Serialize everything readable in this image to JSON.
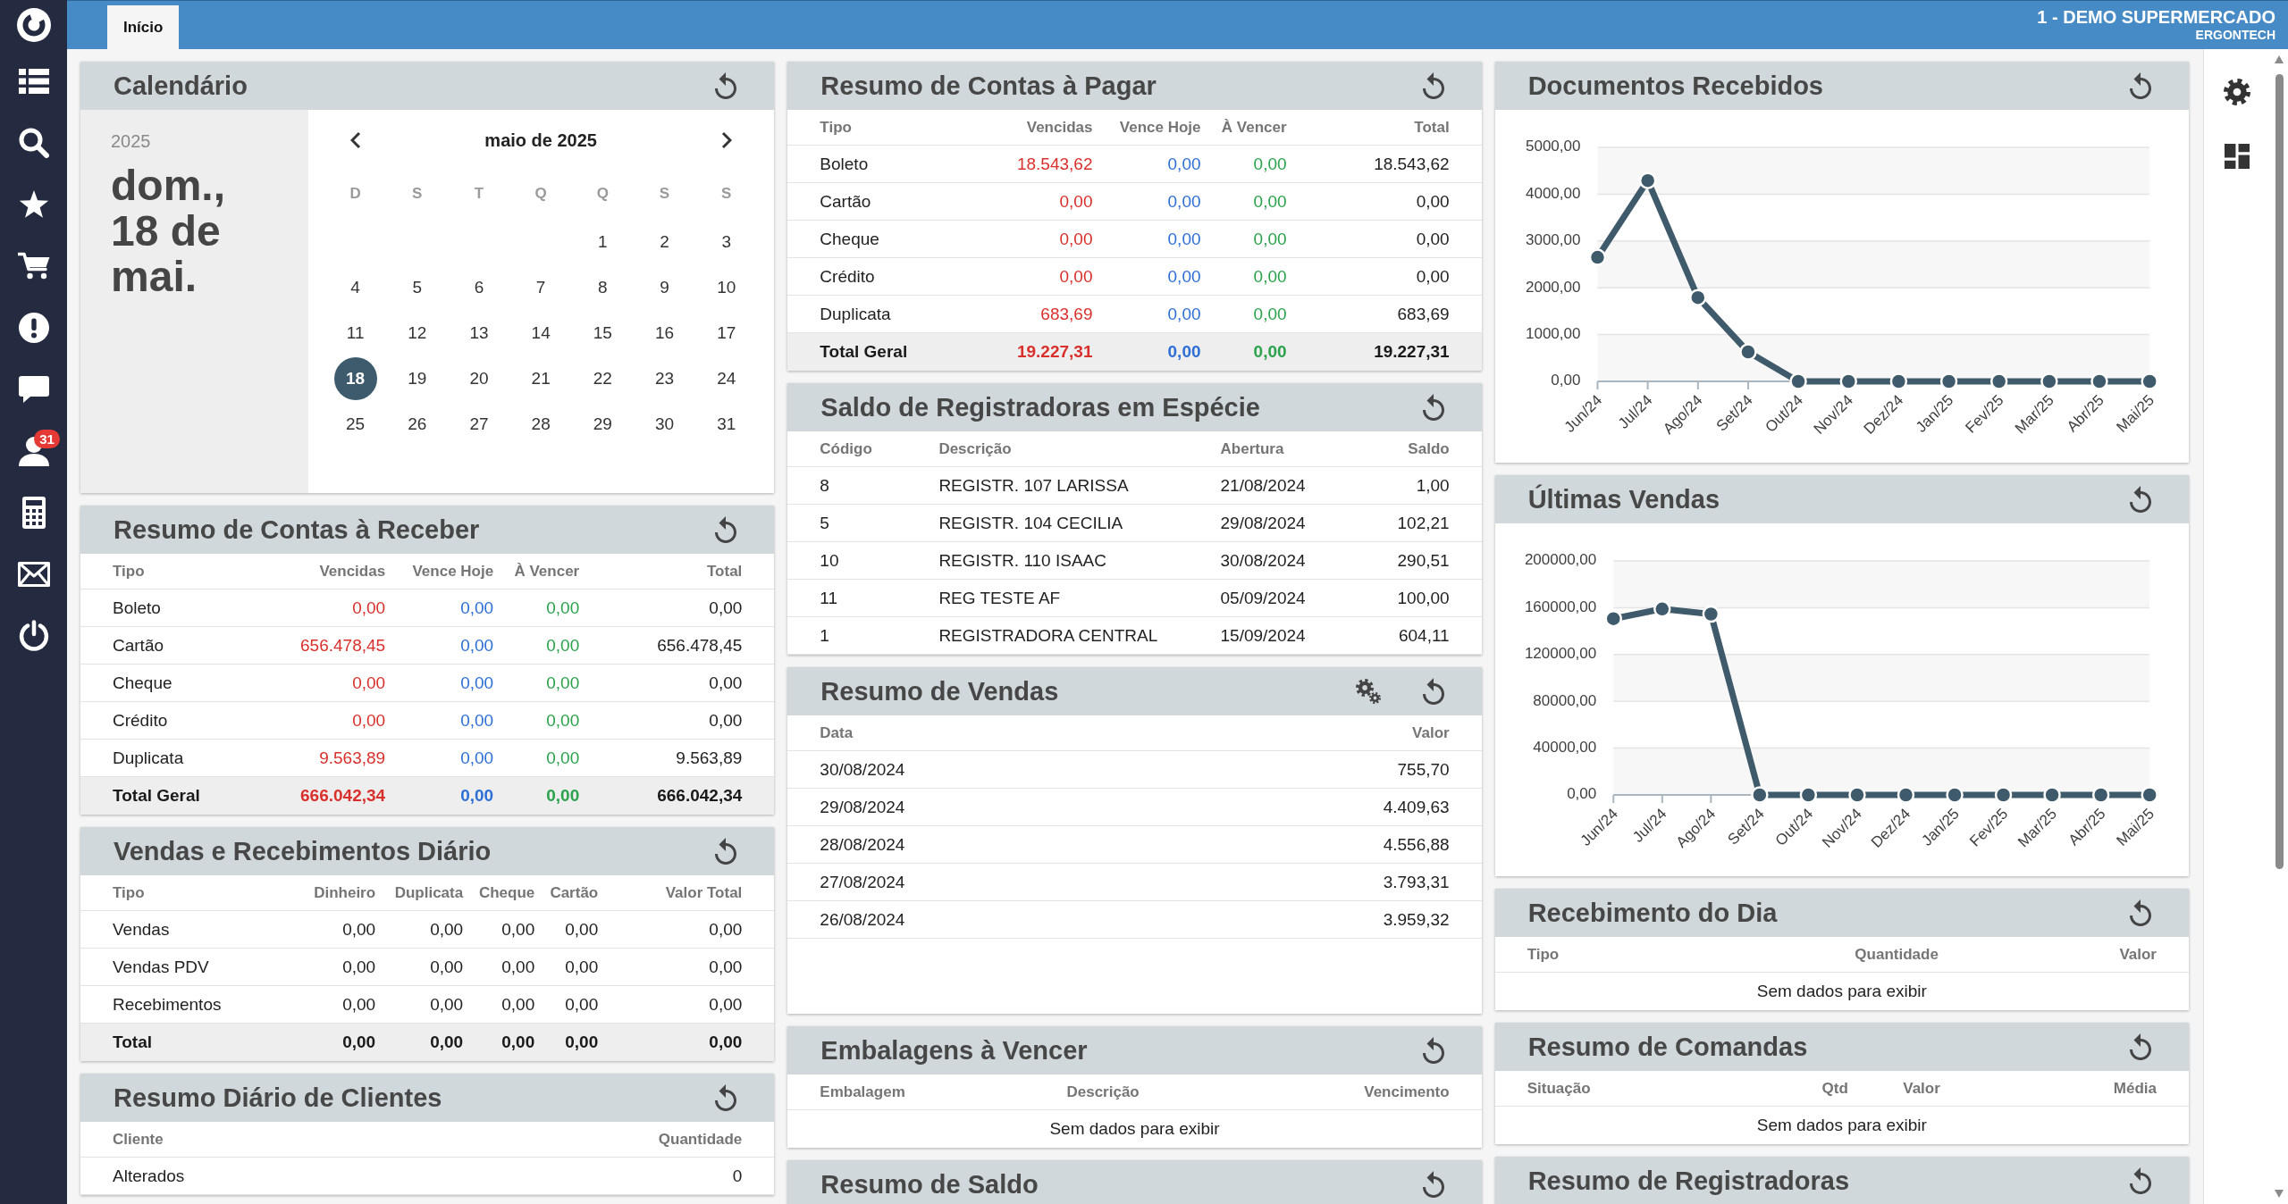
{
  "sidebar": {
    "badge": "31"
  },
  "tabs": [
    {
      "label": "Início",
      "selected": true
    }
  ],
  "account": {
    "name": "1 - DEMO SUPERMERCADO",
    "company": "ERGONTECH"
  },
  "columns": [
    {
      "cards": [
        {
          "kind": "calendar",
          "title": "Calendário",
          "settings_button": false,
          "year": "2025",
          "date": "dom., 18 de mai.",
          "month": "maio de 2025",
          "weekdays": [
            "D",
            "S",
            "T",
            "Q",
            "Q",
            "S",
            "S"
          ],
          "weeks": [
            {
              "days": [
                {
                  "label": "1",
                  "selected": false
                },
                {
                  "label": "2",
                  "selected": false
                },
                {
                  "label": "3",
                  "selected": false
                }
              ]
            },
            {
              "days": [
                {
                  "label": "4",
                  "selected": false
                },
                {
                  "label": "5",
                  "selected": false
                },
                {
                  "label": "6",
                  "selected": false
                },
                {
                  "label": "7",
                  "selected": false
                },
                {
                  "label": "8",
                  "selected": false
                },
                {
                  "label": "9",
                  "selected": false
                },
                {
                  "label": "10",
                  "selected": false
                }
              ]
            },
            {
              "days": [
                {
                  "label": "11",
                  "selected": false
                },
                {
                  "label": "12",
                  "selected": false
                },
                {
                  "label": "13",
                  "selected": false
                },
                {
                  "label": "14",
                  "selected": false
                },
                {
                  "label": "15",
                  "selected": false
                },
                {
                  "label": "16",
                  "selected": false
                },
                {
                  "label": "17",
                  "selected": false
                }
              ]
            },
            {
              "days": [
                {
                  "label": "18",
                  "selected": true
                },
                {
                  "label": "19",
                  "selected": false
                },
                {
                  "label": "20",
                  "selected": false
                },
                {
                  "label": "21",
                  "selected": false
                },
                {
                  "label": "22",
                  "selected": false
                },
                {
                  "label": "23",
                  "selected": false
                },
                {
                  "label": "24",
                  "selected": false
                }
              ]
            },
            {
              "days": [
                {
                  "label": "25",
                  "selected": false
                },
                {
                  "label": "26",
                  "selected": false
                },
                {
                  "label": "27",
                  "selected": false
                },
                {
                  "label": "28",
                  "selected": false
                },
                {
                  "label": "29",
                  "selected": false
                },
                {
                  "label": "30",
                  "selected": false
                },
                {
                  "label": "31",
                  "selected": false
                }
              ]
            }
          ]
        },
        {
          "kind": "table",
          "title": "Resumo de Contas à Receber",
          "settings_button": false,
          "table": {
            "columns": [
              {
                "label": "Tipo"
              },
              {
                "label": "Vencidas",
                "color": "#d9302c"
              },
              {
                "label": "Vence Hoje",
                "color": "#2d6fd6"
              },
              {
                "label": "À Vencer",
                "color": "#2ba24c"
              },
              {
                "label": "Total"
              }
            ],
            "rows": [
              [
                "Boleto",
                "0,00",
                "0,00",
                "0,00",
                "0,00"
              ],
              [
                "Cartão",
                "656.478,45",
                "0,00",
                "0,00",
                "656.478,45"
              ],
              [
                "Cheque",
                "0,00",
                "0,00",
                "0,00",
                "0,00"
              ],
              [
                "Crédito",
                "0,00",
                "0,00",
                "0,00",
                "0,00"
              ],
              [
                "Duplicata",
                "9.563,89",
                "0,00",
                "0,00",
                "9.563,89"
              ]
            ],
            "total": [
              "Total Geral",
              "666.042,34",
              "0,00",
              "0,00",
              "666.042,34"
            ]
          }
        },
        {
          "kind": "table",
          "title": "Vendas e Recebimentos Diário",
          "settings_button": false,
          "table": {
            "columns": [
              {
                "label": "Tipo"
              },
              {
                "label": "Dinheiro"
              },
              {
                "label": "Duplicata"
              },
              {
                "label": "Cheque"
              },
              {
                "label": "Cartão"
              },
              {
                "label": "Valor Total"
              }
            ],
            "rows": [
              [
                "Vendas",
                "0,00",
                "0,00",
                "0,00",
                "0,00",
                "0,00"
              ],
              [
                "Vendas PDV",
                "0,00",
                "0,00",
                "0,00",
                "0,00",
                "0,00"
              ],
              [
                "Recebimentos",
                "0,00",
                "0,00",
                "0,00",
                "0,00",
                "0,00"
              ]
            ],
            "total": [
              "Total",
              "0,00",
              "0,00",
              "0,00",
              "0,00",
              "0,00"
            ]
          }
        },
        {
          "kind": "table",
          "title": "Resumo Diário de Clientes",
          "settings_button": false,
          "table": {
            "columns": [
              {
                "label": "Cliente"
              },
              {
                "label": "Quantidade"
              }
            ],
            "rows": [
              [
                "Alterados",
                "0"
              ]
            ]
          }
        }
      ]
    },
    {
      "cards": [
        {
          "kind": "table",
          "title": "Resumo de Contas à Pagar",
          "settings_button": false,
          "table": {
            "columns": [
              {
                "label": "Tipo"
              },
              {
                "label": "Vencidas",
                "color": "#d9302c"
              },
              {
                "label": "Vence Hoje",
                "color": "#2d6fd6"
              },
              {
                "label": "À Vencer",
                "color": "#2ba24c"
              },
              {
                "label": "Total"
              }
            ],
            "rows": [
              [
                "Boleto",
                "18.543,62",
                "0,00",
                "0,00",
                "18.543,62"
              ],
              [
                "Cartão",
                "0,00",
                "0,00",
                "0,00",
                "0,00"
              ],
              [
                "Cheque",
                "0,00",
                "0,00",
                "0,00",
                "0,00"
              ],
              [
                "Crédito",
                "0,00",
                "0,00",
                "0,00",
                "0,00"
              ],
              [
                "Duplicata",
                "683,69",
                "0,00",
                "0,00",
                "683,69"
              ]
            ],
            "total": [
              "Total Geral",
              "19.227,31",
              "0,00",
              "0,00",
              "19.227,31"
            ]
          }
        },
        {
          "kind": "table",
          "title": "Saldo de Registradoras em Espécie",
          "settings_button": false,
          "table": {
            "columns": [
              {
                "label": "Código"
              },
              {
                "label": "Descrição"
              },
              {
                "label": "Abertura"
              },
              {
                "label": "Saldo"
              }
            ],
            "rows": [
              [
                "8",
                "REGISTR. 107 LARISSA",
                "21/08/2024",
                "1,00"
              ],
              [
                "5",
                "REGISTR. 104 CECILIA",
                "29/08/2024",
                "102,21"
              ],
              [
                "10",
                "REGISTR. 110 ISAAC",
                "30/08/2024",
                "290,51"
              ],
              [
                "11",
                "REG TESTE AF",
                "05/09/2024",
                "100,00"
              ],
              [
                "1",
                "REGISTRADORA CENTRAL",
                "15/09/2024",
                "604,11"
              ]
            ]
          }
        },
        {
          "kind": "table",
          "title": "Resumo de Vendas",
          "settings_button": true,
          "table": {
            "columns": [
              {
                "label": "Data"
              },
              {
                "label": "Valor"
              }
            ],
            "rows": [
              [
                "30/08/2024",
                "755,70"
              ],
              [
                "29/08/2024",
                "4.409,63"
              ],
              [
                "28/08/2024",
                "4.556,88"
              ],
              [
                "27/08/2024",
                "3.793,31"
              ],
              [
                "26/08/2024",
                "3.959,32"
              ]
            ]
          }
        },
        {
          "kind": "table",
          "title": "Embalagens à Vencer",
          "settings_button": false,
          "table": {
            "columns": [
              {
                "label": "Embalagem"
              },
              {
                "label": "Descrição"
              },
              {
                "label": "Vencimento"
              }
            ],
            "empty_text": "Sem dados para exibir"
          }
        },
        {
          "kind": "table",
          "title": "Resumo de Saldo",
          "settings_button": false
        }
      ]
    },
    {
      "cards": [
        {
          "kind": "chart",
          "title": "Documentos Recebidos",
          "settings_button": false,
          "chart_data": {
            "type": "line",
            "grid": true,
            "categories": [
              "Jun/24",
              "Jul/24",
              "Ago/24",
              "Set/24",
              "Out/24",
              "Nov/24",
              "Dez/24",
              "Jan/25",
              "Fev/25",
              "Mar/25",
              "Abr/25",
              "Mai/25"
            ],
            "series": [
              {
                "color": "#3e5a6b",
                "marker": "circle",
                "values": [
                  2650,
                  4290,
                  1790,
                  630,
                  0,
                  0,
                  0,
                  0,
                  0,
                  0,
                  0,
                  0
                ]
              }
            ],
            "ylim": [
              0,
              5000
            ],
            "yticks": [
              {
                "value": 0,
                "label": "0,00"
              },
              {
                "value": 1000,
                "label": "1000,00"
              },
              {
                "value": 2000,
                "label": "2000,00"
              },
              {
                "value": 3000,
                "label": "3000,00"
              },
              {
                "value": 4000,
                "label": "4000,00"
              },
              {
                "value": 5000,
                "label": "5000,00"
              }
            ]
          }
        },
        {
          "kind": "chart",
          "title": "Últimas Vendas",
          "settings_button": false,
          "chart_data": {
            "type": "line",
            "grid": true,
            "categories": [
              "Jun/24",
              "Jul/24",
              "Ago/24",
              "Set/24",
              "Out/24",
              "Nov/24",
              "Dez/24",
              "Jan/25",
              "Fev/25",
              "Mar/25",
              "Abr/25",
              "Mai/25"
            ],
            "series": [
              {
                "color": "#3e5a6b",
                "marker": "circle",
                "values": [
                  150600,
                  158900,
                  154600,
                  0,
                  0,
                  0,
                  0,
                  0,
                  0,
                  0,
                  0,
                  0
                ]
              }
            ],
            "ylim": [
              0,
              200000
            ],
            "yticks": [
              {
                "value": 0,
                "label": "0,00"
              },
              {
                "value": 40000,
                "label": "40000,00"
              },
              {
                "value": 80000,
                "label": "80000,00"
              },
              {
                "value": 120000,
                "label": "120000,00"
              },
              {
                "value": 160000,
                "label": "160000,00"
              },
              {
                "value": 200000,
                "label": "200000,00"
              }
            ]
          }
        },
        {
          "kind": "table",
          "title": "Recebimento do Dia",
          "settings_button": false,
          "table": {
            "columns": [
              {
                "label": "Tipo"
              },
              {
                "label": "Quantidade"
              },
              {
                "label": "Valor"
              }
            ],
            "empty_text": "Sem dados para exibir"
          }
        },
        {
          "kind": "table",
          "title": "Resumo de Comandas",
          "settings_button": false,
          "table": {
            "columns": [
              {
                "label": "Situação"
              },
              {
                "label": "Qtd"
              },
              {
                "label": "Valor"
              },
              {
                "label": "Média"
              }
            ],
            "empty_text": "Sem dados para exibir"
          }
        },
        {
          "kind": "table",
          "title": "Resumo de Registradoras",
          "settings_button": false
        }
      ]
    }
  ]
}
